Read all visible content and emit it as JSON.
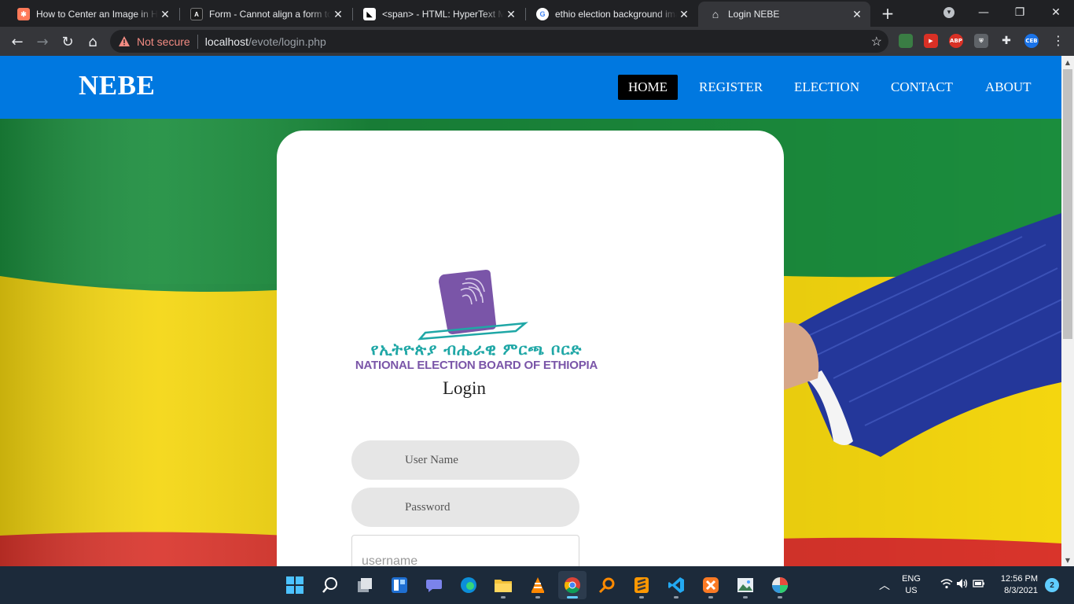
{
  "browser": {
    "tabs": [
      {
        "title": "How to Center an Image in HTML",
        "favicon": "orange-hub-icon",
        "active": false
      },
      {
        "title": "Form - Cannot align a form to center",
        "favicon": "a-letter-icon",
        "active": false
      },
      {
        "title": "<span> - HTML: HyperText Markup Language",
        "favicon": "mdn-dino-icon",
        "active": false
      },
      {
        "title": "ethio election background images",
        "favicon": "google-g-icon",
        "active": false
      },
      {
        "title": "Login NEBE",
        "favicon": "home-icon",
        "active": true
      }
    ],
    "security_text": "Not secure",
    "url_host": "localhost",
    "url_path": "/evote/login.php",
    "extensions": [
      {
        "name": "extension-globe-icon",
        "label": ""
      },
      {
        "name": "extension-red-icon",
        "label": ""
      },
      {
        "name": "adblock-icon",
        "label": "ABP"
      },
      {
        "name": "shield-extension-icon",
        "label": ""
      },
      {
        "name": "puzzle-extensions-icon",
        "label": ""
      },
      {
        "name": "profile-avatar-icon",
        "label": "CEB"
      }
    ]
  },
  "site": {
    "brand": "NEBE",
    "nav": [
      {
        "label": "HOME",
        "active": true
      },
      {
        "label": "REGISTER",
        "active": false
      },
      {
        "label": "ELECTION",
        "active": false
      },
      {
        "label": "CONTACT",
        "active": false
      },
      {
        "label": "ABOUT",
        "active": false
      }
    ],
    "logo": {
      "amharic": "የኢትዮጵያ ብሔራዊ ምርጫ ቦርድ",
      "english": "NATIONAL ELECTION BOARD OF ETHIOPIA"
    },
    "login_heading": "Login",
    "username_label": "User Name",
    "password_label": "Password",
    "username_placeholder": "username"
  },
  "taskbar": {
    "apps": [
      "windows-start-icon",
      "search-icon",
      "task-view-icon",
      "widgets-icon",
      "teams-chat-icon",
      "edge-icon",
      "file-explorer-icon",
      "vlc-icon",
      "chrome-icon",
      "magnifier-app-icon",
      "sublime-text-icon",
      "vscode-icon",
      "xampp-icon",
      "photos-icon",
      "color-picker-icon"
    ],
    "lang_top": "ENG",
    "lang_bottom": "US",
    "time": "12:56 PM",
    "date": "8/3/2021",
    "notifications": "2"
  },
  "colors": {
    "nav_blue": "#0078e0",
    "flag_green": "#1a8a3c",
    "flag_yellow": "#f5d90f",
    "flag_red": "#d9342b",
    "logo_purple": "#7a55a8",
    "logo_teal": "#1fa7a6"
  }
}
